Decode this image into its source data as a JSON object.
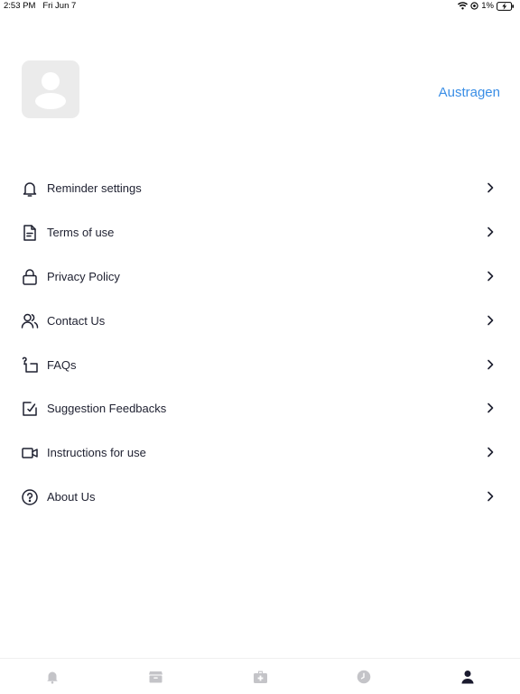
{
  "status_bar": {
    "time": "2:53 PM",
    "date": "Fri Jun 7",
    "battery": "1%"
  },
  "profile": {
    "logout_label": "Austragen"
  },
  "menu": {
    "items": [
      {
        "label": "Reminder settings",
        "icon": "bell-icon"
      },
      {
        "label": "Terms of use",
        "icon": "document-icon"
      },
      {
        "label": "Privacy Policy",
        "icon": "lock-icon"
      },
      {
        "label": "Contact Us",
        "icon": "users-icon"
      },
      {
        "label": "FAQs",
        "icon": "faq-icon"
      },
      {
        "label": "Suggestion Feedbacks",
        "icon": "edit-icon"
      },
      {
        "label": "Instructions for use",
        "icon": "video-icon"
      },
      {
        "label": "About Us",
        "icon": "question-circle-icon"
      }
    ]
  },
  "tabbar": {
    "tabs": [
      {
        "icon": "bell-icon",
        "active": false
      },
      {
        "icon": "archive-box-icon",
        "active": false
      },
      {
        "icon": "first-aid-kit-icon",
        "active": false
      },
      {
        "icon": "clock-icon",
        "active": false
      },
      {
        "icon": "person-icon",
        "active": true
      }
    ],
    "active_color": "#1a1a2e",
    "inactive_color": "#c4c4c8"
  }
}
